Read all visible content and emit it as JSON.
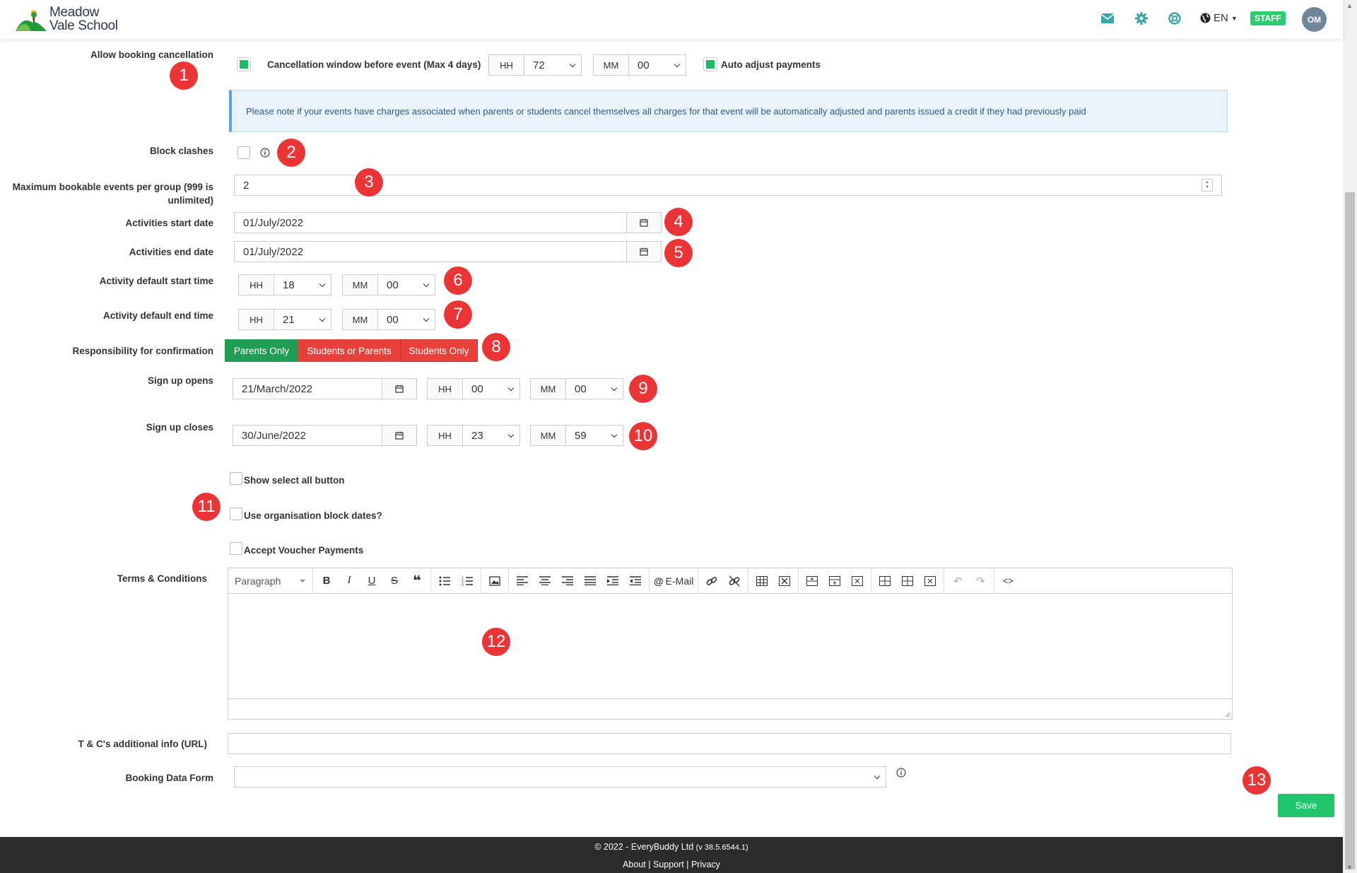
{
  "header": {
    "school_name_line1": "Meadow",
    "school_name_line2": "Vale School",
    "language": "EN",
    "role_badge": "STAFF",
    "avatar_initials": "OM",
    "icons": [
      "mail-icon",
      "gear-icon",
      "help-lifebuoy-icon",
      "globe-icon"
    ],
    "accent_color": "#3aa6a9"
  },
  "cancellation": {
    "label": "Allow booking cancellation",
    "enabled": true,
    "window_label": "Cancellation window before event (Max 4 days)",
    "hh_label": "HH",
    "hh_value": "72",
    "mm_label": "MM",
    "mm_value": "00",
    "auto_adjust_label": "Auto adjust payments",
    "auto_adjust": true,
    "note": "Please note if your events have charges associated when parents or students cancel themselves all charges for that event will be automatically adjusted and parents issued a credit if they had previously paid"
  },
  "block_clashes": {
    "label": "Block clashes",
    "checked": false
  },
  "max_events": {
    "label_line1": "Maximum bookable events per group (999 is",
    "label_line2": "unlimited)",
    "value": "2"
  },
  "activities_start": {
    "label": "Activities start date",
    "value": "01/July/2022"
  },
  "activities_end": {
    "label": "Activities end date",
    "value": "01/July/2022"
  },
  "default_start_time": {
    "label": "Activity default start time",
    "hh_label": "HH",
    "hh": "18",
    "mm_label": "MM",
    "mm": "00"
  },
  "default_end_time": {
    "label": "Activity default end time",
    "hh_label": "HH",
    "hh": "21",
    "mm_label": "MM",
    "mm": "00"
  },
  "responsibility": {
    "label": "Responsibility for confirmation",
    "options": [
      "Parents Only",
      "Students or Parents",
      "Students Only"
    ],
    "selected": "Parents Only",
    "selected_color": "#1f9d55",
    "unselected_color": "#e8413c"
  },
  "sign_up_opens": {
    "label": "Sign up opens",
    "date": "21/March/2022",
    "hh_label": "HH",
    "hh": "00",
    "mm_label": "MM",
    "mm": "00"
  },
  "sign_up_closes": {
    "label": "Sign up closes",
    "date": "30/June/2022",
    "hh_label": "HH",
    "hh": "23",
    "mm_label": "MM",
    "mm": "59"
  },
  "options": {
    "show_select_all": "Show select all button",
    "use_block_dates": "Use organisation block dates?",
    "accept_voucher": "Accept Voucher Payments"
  },
  "terms": {
    "label": "Terms & Conditions",
    "paragraph_select": "Paragraph",
    "email_button": "E-Mail"
  },
  "tc_url": {
    "label": "T & C's additional info (URL)",
    "value": ""
  },
  "booking_form": {
    "label": "Booking Data Form",
    "value": ""
  },
  "save_label": "Save",
  "badges": [
    "1",
    "2",
    "3",
    "4",
    "5",
    "6",
    "7",
    "8",
    "9",
    "10",
    "11",
    "12",
    "13"
  ],
  "footer": {
    "copyright": "© 2022 - EveryBuddy Ltd",
    "version": "(v 38.5.6544.1)",
    "links": [
      "About",
      "Support",
      "Privacy"
    ],
    "separator": "|"
  }
}
